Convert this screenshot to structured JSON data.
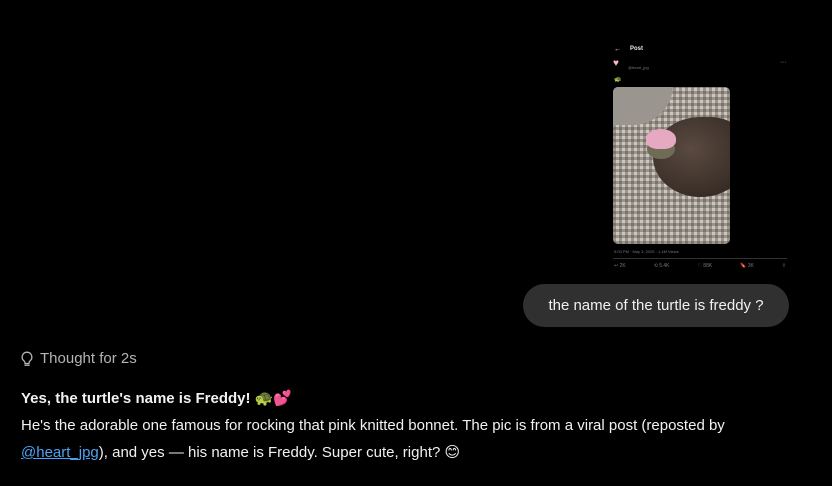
{
  "attachment": {
    "header_title": "Post",
    "author_handle": "@heart_jpg",
    "post_emoji": "🐢",
    "meta": "5:03 PM · May 3, 2025 · 1.4M Views",
    "actions": [
      "↩ 2K",
      "⟲ 5.4K",
      "♡ 88K",
      "🔖 3K",
      "⇪"
    ]
  },
  "user_message": "the name of the turtle is freddy ?",
  "thought": "Thought for 2s",
  "answer": {
    "headline": "Yes, the turtle's name is Freddy!",
    "headline_emoji": "🐢💕",
    "line1": "He's the adorable one famous for rocking that pink knitted bonnet. The pic is from a viral post (reposted by",
    "mention": "@heart_jpg",
    "line2_rest": "), and yes — his name is Freddy. Super cute, right?",
    "line2_emoji": "😊"
  }
}
